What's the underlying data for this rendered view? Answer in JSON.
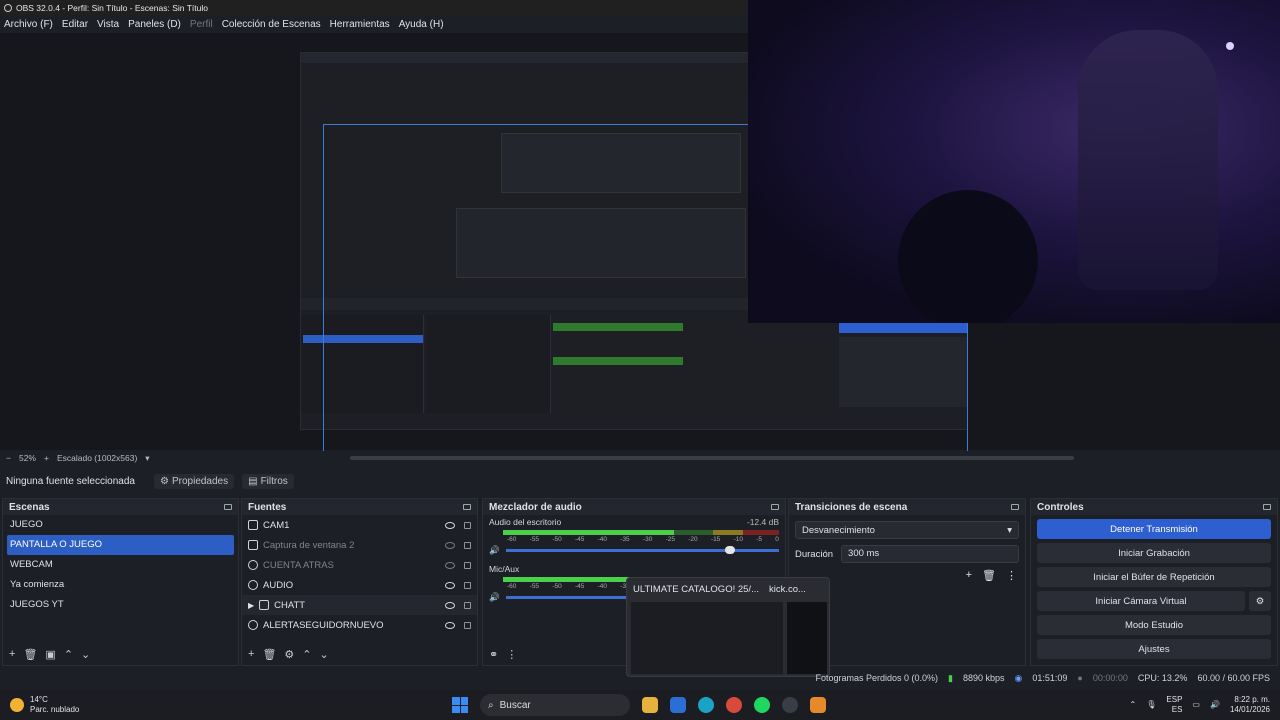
{
  "window": {
    "title": "OBS 32.0.4 - Perfil: Sin Título - Escenas: Sin Título"
  },
  "menu": [
    "Archivo (F)",
    "Editar",
    "Vista",
    "Paneles (D)",
    "Perfil",
    "Colección de Escenas",
    "Herramientas",
    "Ayuda (H)"
  ],
  "zoom": {
    "minus": "−",
    "percent": "52%",
    "plus": "+",
    "scaled": "Escalado (1002x563)"
  },
  "properties_bar": {
    "no_source": "Ninguna fuente seleccionada",
    "properties": "Propiedades",
    "filters": "Filtros"
  },
  "scenes": {
    "title": "Escenas",
    "items": [
      "JUEGO",
      "PANTALLA O JUEGO",
      "WEBCAM",
      "Ya comienza",
      "JUEGOS YT"
    ],
    "selected": "PANTALLA O JUEGO"
  },
  "sources": {
    "title": "Fuentes",
    "items": [
      {
        "name": "CAM1",
        "icon": "camera-icon",
        "visible": true
      },
      {
        "name": "Captura de ventana 2",
        "icon": "window-icon",
        "visible": false
      },
      {
        "name": "CUENTA ATRAS",
        "icon": "globe-icon",
        "visible": false
      },
      {
        "name": "AUDIO",
        "icon": "globe-icon",
        "visible": true
      },
      {
        "name": "CHATT",
        "icon": "folder-icon",
        "visible": true
      },
      {
        "name": "ALERTASEGUIDORNUEVO",
        "icon": "globe-icon",
        "visible": true
      }
    ]
  },
  "mixer": {
    "title": "Mezclador de audio",
    "channels": [
      {
        "name": "Audio del escritorio",
        "db": "-12.4 dB",
        "level": 0.62,
        "volume": 0.82
      },
      {
        "name": "Mic/Aux",
        "db": "",
        "level": 0.58,
        "volume": 0.6
      }
    ],
    "ticks": [
      "-60",
      "-55",
      "-50",
      "-45",
      "-40",
      "-35",
      "-30",
      "-25",
      "-20",
      "-15",
      "-10",
      "-5",
      "0"
    ]
  },
  "transitions": {
    "title": "Transiciones de escena",
    "selected": "Desvanecimiento",
    "duration_label": "Duración",
    "duration_value": "300 ms"
  },
  "controls": {
    "title": "Controles",
    "buttons": [
      "Detener Transmisión",
      "Iniciar Grabación",
      "Iniciar el Búfer de Repetición",
      "Iniciar Cámara Virtual",
      "Modo Estudio",
      "Ajustes"
    ]
  },
  "popup": {
    "tab1": "ULTIMATE CATALOGO! 25/...",
    "tab2": "kick.co..."
  },
  "status": {
    "dropped": "Fotogramas Perdidos 0 (0.0%)",
    "bitrate": "8890 kbps",
    "stream_time": "01:51:09",
    "rec_time": "00:00:00",
    "cpu": "CPU: 13.2%",
    "fps": "60.00 / 60.00 FPS"
  },
  "taskbar": {
    "temp": "14°C",
    "weather": "Parc. nublado",
    "search": "Buscar",
    "lang1": "ESP",
    "lang2": "ES",
    "time": "8:22 p. m.",
    "date": "14/01/2026"
  },
  "colors": {
    "accent": "#2d5fd0",
    "meter_green": "#4cd04c",
    "meter_yellow": "#8a7b22",
    "meter_red": "#7a2222"
  }
}
